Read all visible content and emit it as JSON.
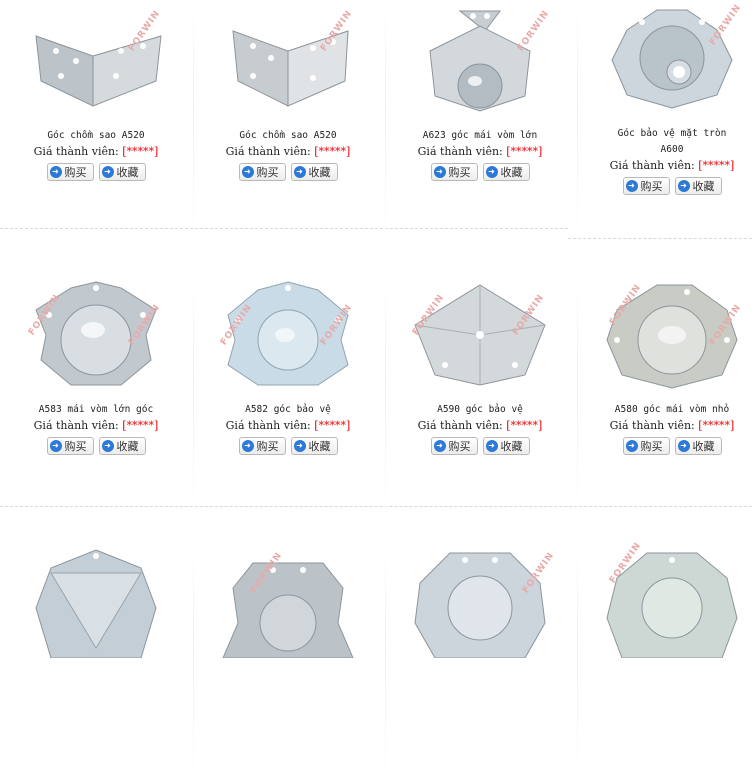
{
  "buttons": {
    "buy_label": "购买",
    "collect_label": "收藏"
  },
  "price_label": "Giá thành viên:",
  "price_mask": "[*****]",
  "watermark": "FORWIN",
  "products": [
    {
      "title": "Góc chồm sao A520",
      "title2": ""
    },
    {
      "title": "Góc chồm sao A520",
      "title2": ""
    },
    {
      "title": "A623 góc mái vòm lớn",
      "title2": ""
    },
    {
      "title": "Góc bảo vệ mặt tròn",
      "title2": "A600"
    },
    {
      "title": "A583 mái vòm lớn góc",
      "title2": ""
    },
    {
      "title": "A582 góc bảo vệ",
      "title2": ""
    },
    {
      "title": "A590 góc bảo vệ",
      "title2": ""
    },
    {
      "title": "A580 góc mái vòm nhỏ",
      "title2": ""
    },
    {
      "title": "",
      "title2": ""
    },
    {
      "title": "",
      "title2": ""
    },
    {
      "title": "",
      "title2": ""
    },
    {
      "title": "",
      "title2": ""
    }
  ]
}
